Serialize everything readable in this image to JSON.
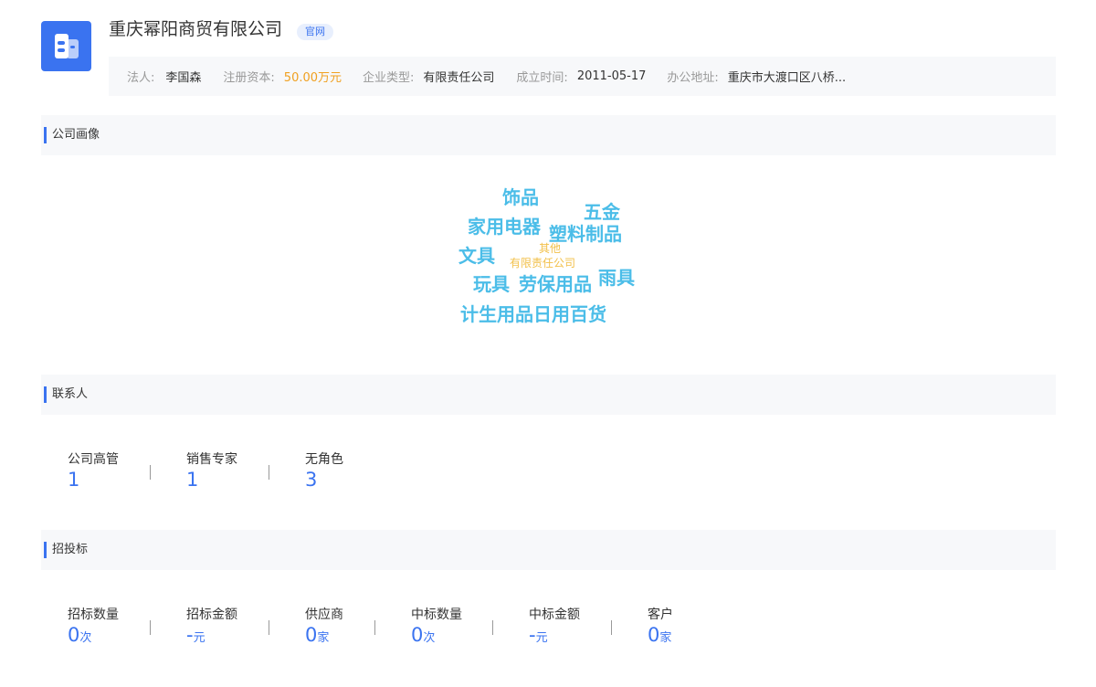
{
  "company": {
    "name": "重庆幂阳商贸有限公司",
    "official_site_badge": "官网",
    "logo_icon": "building-icon"
  },
  "info": [
    {
      "key": "法人:",
      "value": "李国森"
    },
    {
      "key": "注册资本:",
      "value": "50.00万元"
    },
    {
      "key": "企业类型:",
      "value": "有限责任公司"
    },
    {
      "key": "成立时间:",
      "value": "2011-05-17"
    },
    {
      "key": "办公地址:",
      "value": "重庆市大渡口区八桥..."
    }
  ],
  "portrait": {
    "title": "公司画像",
    "words": [
      "饰品",
      "五金",
      "家用电器",
      "塑料制品",
      "文具",
      "其他",
      "有限责任公司",
      "玩具",
      "劳保用品",
      "雨具",
      "计生用品日用百货"
    ]
  },
  "contacts": {
    "title": "联系人",
    "stats": [
      {
        "label": "公司高管",
        "value": "1"
      },
      {
        "label": "销售专家",
        "value": "1"
      },
      {
        "label": "无角色",
        "value": "3"
      }
    ]
  },
  "bidding": {
    "title": "招投标",
    "stats": [
      {
        "label": "招标数量",
        "value": "0",
        "unit": "次"
      },
      {
        "label": "招标金额",
        "value": "-",
        "unit": "元"
      },
      {
        "label": "供应商",
        "value": "0",
        "unit": "家"
      },
      {
        "label": "中标数量",
        "value": "0",
        "unit": "次"
      },
      {
        "label": "中标金额",
        "value": "-",
        "unit": "元"
      },
      {
        "label": "客户",
        "value": "0",
        "unit": "家"
      }
    ]
  },
  "colors": {
    "accent": "#3a73f0",
    "money": "#f0a020",
    "cloud_primary": "#4bbde8",
    "cloud_secondary": "#f2c04a"
  }
}
